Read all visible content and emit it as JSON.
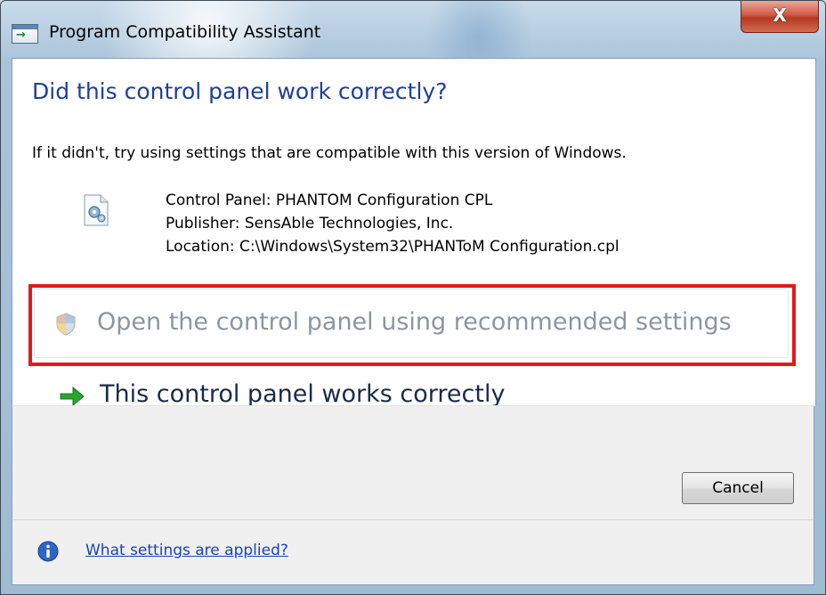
{
  "window": {
    "title": "Program Compatibility Assistant",
    "close_label": "X"
  },
  "main": {
    "heading": "Did this control panel work correctly?",
    "description": "If it didn't, try using settings that are compatible with this version of Windows.",
    "details": {
      "control_panel": "Control Panel: PHANTOM Configuration CPL",
      "publisher": "Publisher: SensAble Technologies, Inc.",
      "location": "Location: C:\\Windows\\System32\\PHANToM Configuration.cpl"
    },
    "options": {
      "recommended": "Open the control panel using recommended settings",
      "works": "This control panel works correctly"
    }
  },
  "buttons": {
    "cancel": "Cancel"
  },
  "footer": {
    "link": "What settings are applied?"
  },
  "icons": {
    "title": "program-compatibility-icon",
    "file": "control-panel-file-icon",
    "shield": "uac-shield-icon",
    "arrow": "green-arrow-icon",
    "info": "info-icon"
  },
  "colors": {
    "heading": "#1e3f9a",
    "disabled_text": "#8b95a3",
    "link": "#1a44b8",
    "highlight": "#e11a1a",
    "arrow": "#2aa52e",
    "close_button": "#c4472f"
  }
}
